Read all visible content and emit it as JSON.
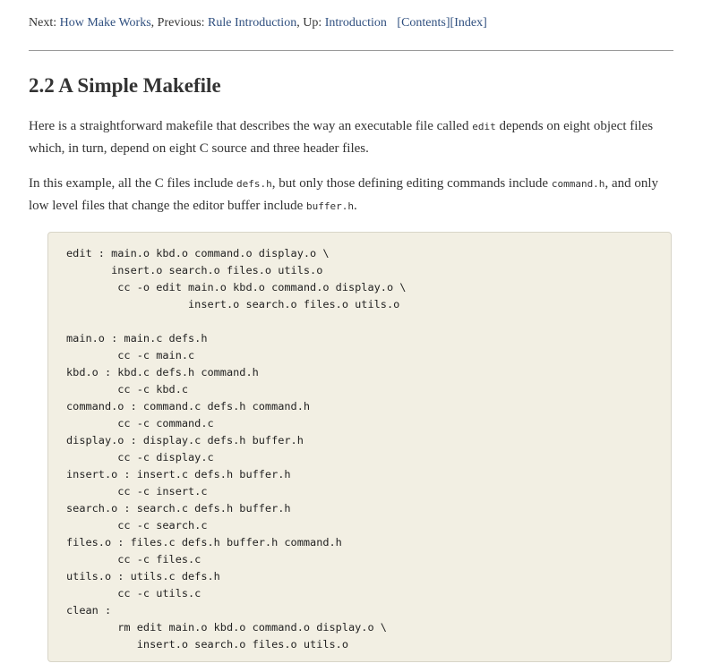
{
  "nav": {
    "next_label": "Next: ",
    "next_link": "How Make Works",
    "prev_label": ", Previous: ",
    "prev_link": "Rule Introduction",
    "up_label": ", Up: ",
    "up_link": "Introduction",
    "contents_link": "[Contents]",
    "index_link": "[Index]"
  },
  "heading": "2.2 A Simple Makefile",
  "para1": {
    "t1": "Here is a straightforward makefile that describes the way an executable file called ",
    "c1": "edit",
    "t2": " depends on eight object files which, in turn, depend on eight C source and three header files."
  },
  "para2": {
    "t1": "In this example, all the C files include ",
    "c1": "defs.h",
    "t2": ", but only those defining editing commands include ",
    "c2": "command.h",
    "t3": ", and only low level files that change the editor buffer include ",
    "c3": "buffer.h",
    "t4": "."
  },
  "code": "edit : main.o kbd.o command.o display.o \\\n       insert.o search.o files.o utils.o\n        cc -o edit main.o kbd.o command.o display.o \\\n                   insert.o search.o files.o utils.o\n\nmain.o : main.c defs.h\n        cc -c main.c\nkbd.o : kbd.c defs.h command.h\n        cc -c kbd.c\ncommand.o : command.c defs.h command.h\n        cc -c command.c\ndisplay.o : display.c defs.h buffer.h\n        cc -c display.c\ninsert.o : insert.c defs.h buffer.h\n        cc -c insert.c\nsearch.o : search.c defs.h buffer.h\n        cc -c search.c\nfiles.o : files.c defs.h buffer.h command.h\n        cc -c files.c\nutils.o : utils.c defs.h\n        cc -c utils.c\nclean :\n        rm edit main.o kbd.o command.o display.o \\\n           insert.o search.o files.o utils.o"
}
